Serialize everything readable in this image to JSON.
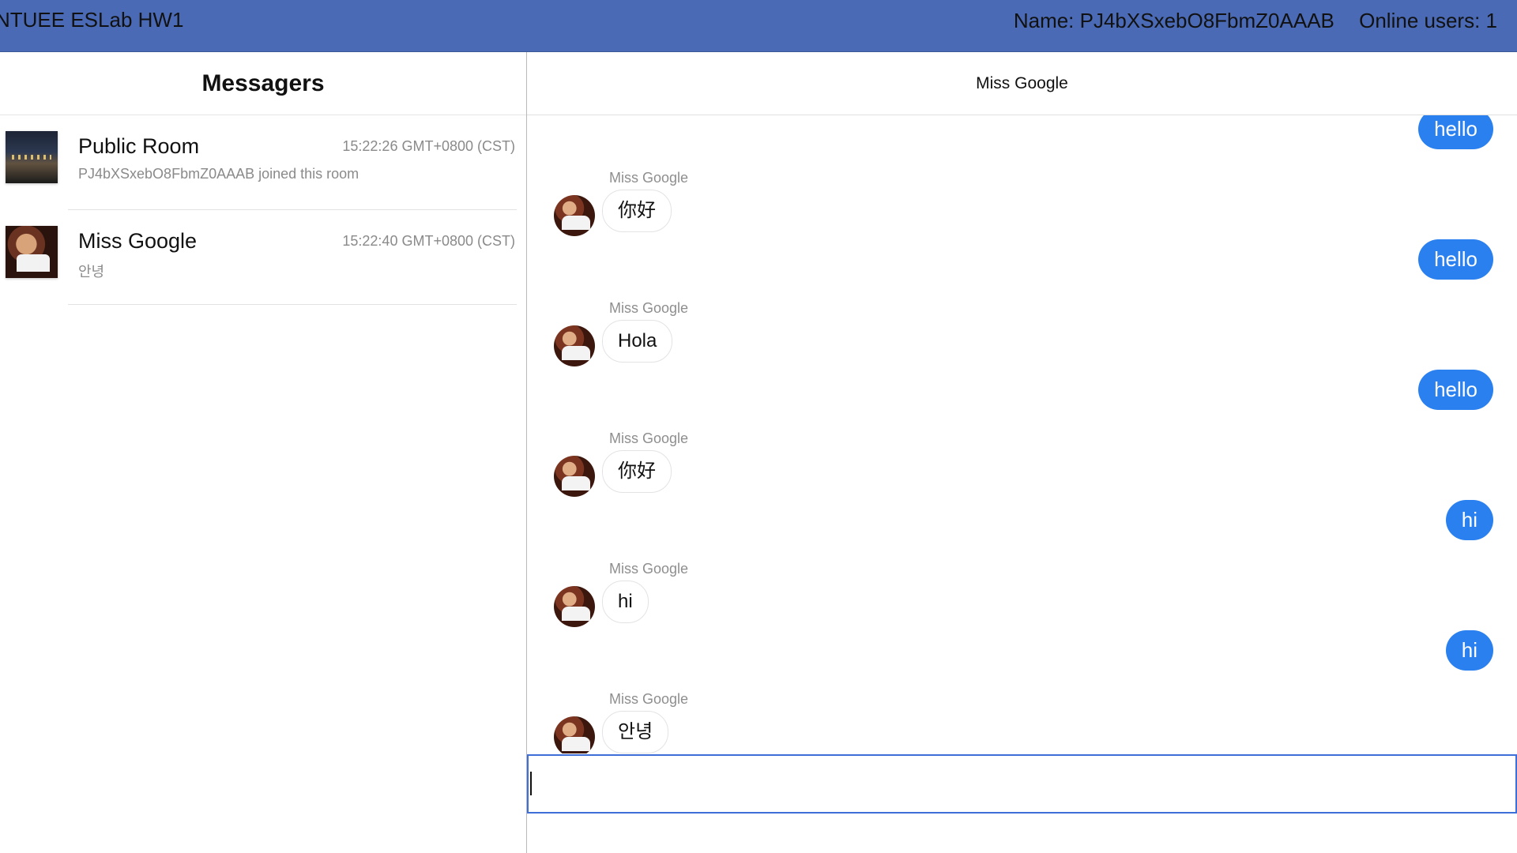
{
  "header": {
    "title": "NTUEE ESLab HW1",
    "name": "Name: PJ4bXSxebO8FbmZ0AAAB",
    "online_users": "Online users: 1"
  },
  "sidebar": {
    "title": "Messagers",
    "conversations": [
      {
        "name": "Public Room",
        "time": "15:22:26 GMT+0800 (CST)",
        "preview": "PJ4bXSxebO8FbmZ0AAAB joined this room"
      },
      {
        "name": "Miss Google",
        "time": "15:22:40 GMT+0800 (CST)",
        "preview": "안녕"
      }
    ]
  },
  "chat": {
    "title": "Miss Google",
    "messages": [
      {
        "dir": "out",
        "text": "hello"
      },
      {
        "dir": "in",
        "sender": "Miss Google",
        "text": "你好"
      },
      {
        "dir": "out",
        "text": "hello"
      },
      {
        "dir": "in",
        "sender": "Miss Google",
        "text": "Hola"
      },
      {
        "dir": "out",
        "text": "hello"
      },
      {
        "dir": "in",
        "sender": "Miss Google",
        "text": "你好"
      },
      {
        "dir": "out",
        "text": "hi"
      },
      {
        "dir": "in",
        "sender": "Miss Google",
        "text": "hi"
      },
      {
        "dir": "out",
        "text": "hi"
      },
      {
        "dir": "in",
        "sender": "Miss Google",
        "text": "안녕"
      }
    ],
    "input_value": ""
  },
  "colors": {
    "header_bg": "#4a6ab5",
    "outgoing_bubble": "#2a80ee",
    "input_border": "#3e6fd8"
  }
}
